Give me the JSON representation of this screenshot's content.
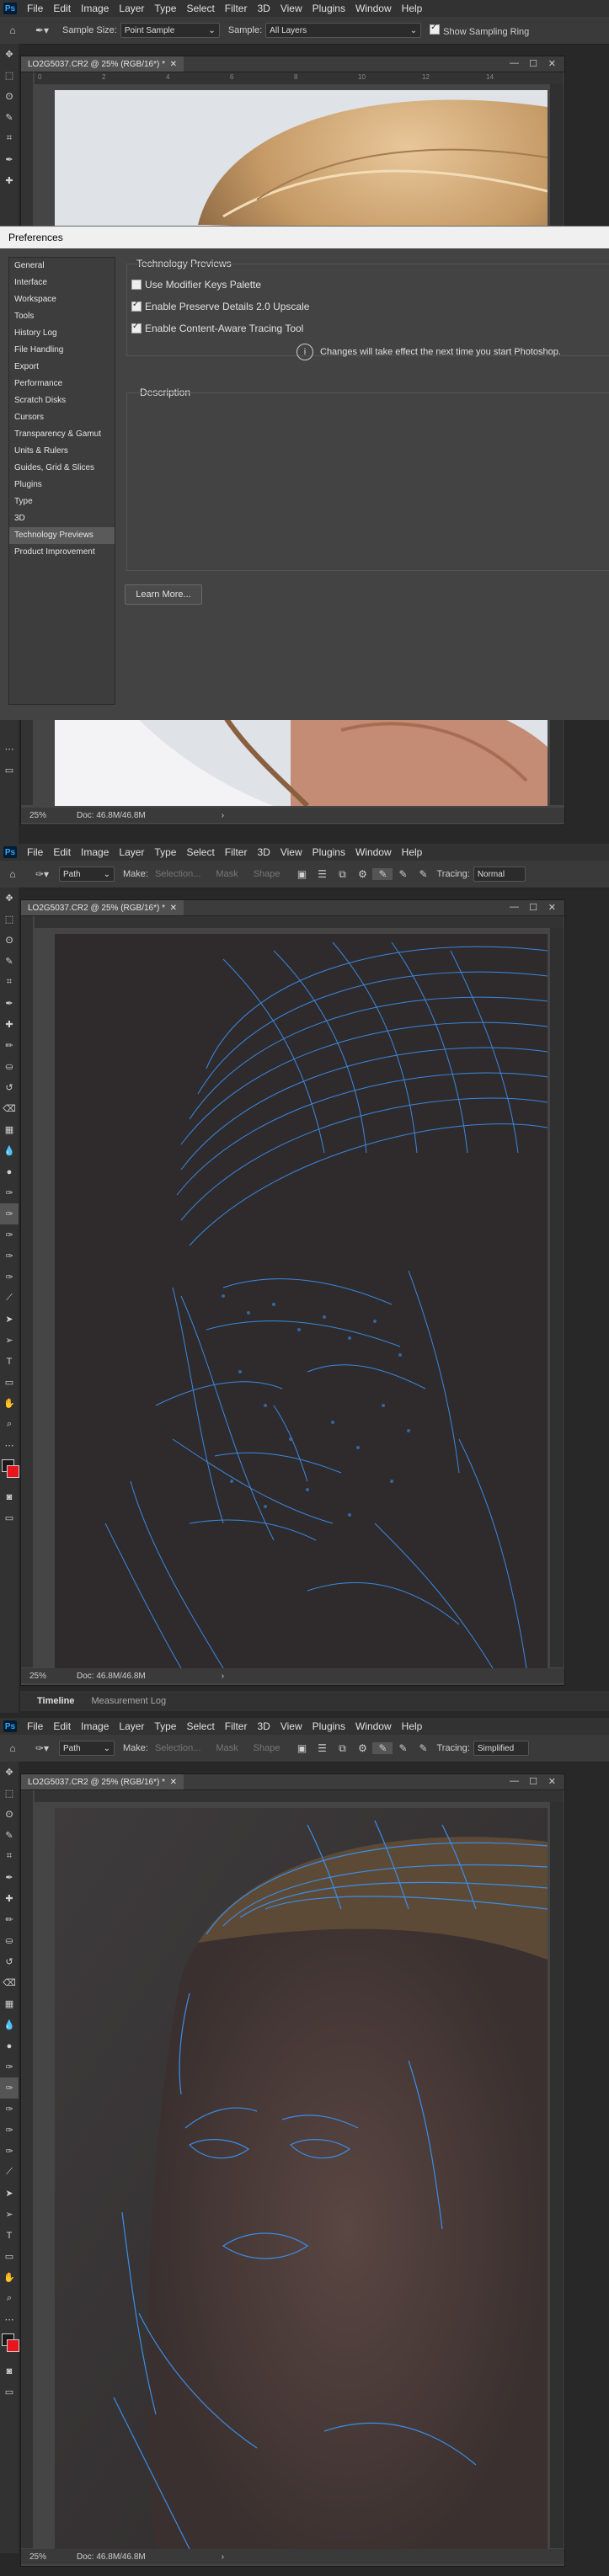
{
  "menu": [
    "File",
    "Edit",
    "Image",
    "Layer",
    "Type",
    "Select",
    "Filter",
    "3D",
    "View",
    "Plugins",
    "Window",
    "Help"
  ],
  "app_badge": "Ps",
  "opts1": {
    "sample_size_label": "Sample Size:",
    "sample_size_value": "Point Sample",
    "sample_label": "Sample:",
    "sample_value": "All Layers",
    "sampling_ring_label": "Show Sampling Ring"
  },
  "doc": {
    "title": "LO2G5037.CR2 @ 25% (RGB/16*) *",
    "zoom": "25%",
    "doc_info": "Doc: 46.8M/46.8M",
    "ruler_ticks": [
      "0",
      "2",
      "4",
      "6",
      "8",
      "10",
      "12",
      "14"
    ]
  },
  "preferences": {
    "title": "Preferences",
    "sidebar": [
      "General",
      "Interface",
      "Workspace",
      "Tools",
      "History Log",
      "File Handling",
      "Export",
      "Performance",
      "Scratch Disks",
      "Cursors",
      "Transparency & Gamut",
      "Units & Rulers",
      "Guides, Grid & Slices",
      "Plugins",
      "Type",
      "3D",
      "Technology Previews",
      "Product Improvement"
    ],
    "active_index": 16,
    "section_title": "Technology Previews",
    "options": [
      {
        "label": "Use Modifier Keys Palette",
        "checked": false
      },
      {
        "label": "Enable Preserve Details 2.0 Upscale",
        "checked": true
      },
      {
        "label": "Enable Content-Aware Tracing Tool",
        "checked": true
      }
    ],
    "restart_note": "Changes will take effect the next time you start Photoshop.",
    "description_title": "Description",
    "learn_more": "Learn More..."
  },
  "opts2": {
    "mode_value": "Path",
    "make_label": "Make:",
    "selection_label": "Selection...",
    "mask_label": "Mask",
    "shape_label": "Shape",
    "tracing_label": "Tracing:",
    "tracing_value_1": "Normal",
    "tracing_value_2": "Simplified"
  },
  "timeline": {
    "tab1": "Timeline",
    "tab2": "Measurement Log"
  },
  "colors": {
    "path_blue": "#3a8de8",
    "fg_swatch": "#1a1a1a",
    "bg_swatch": "#e8141e"
  }
}
